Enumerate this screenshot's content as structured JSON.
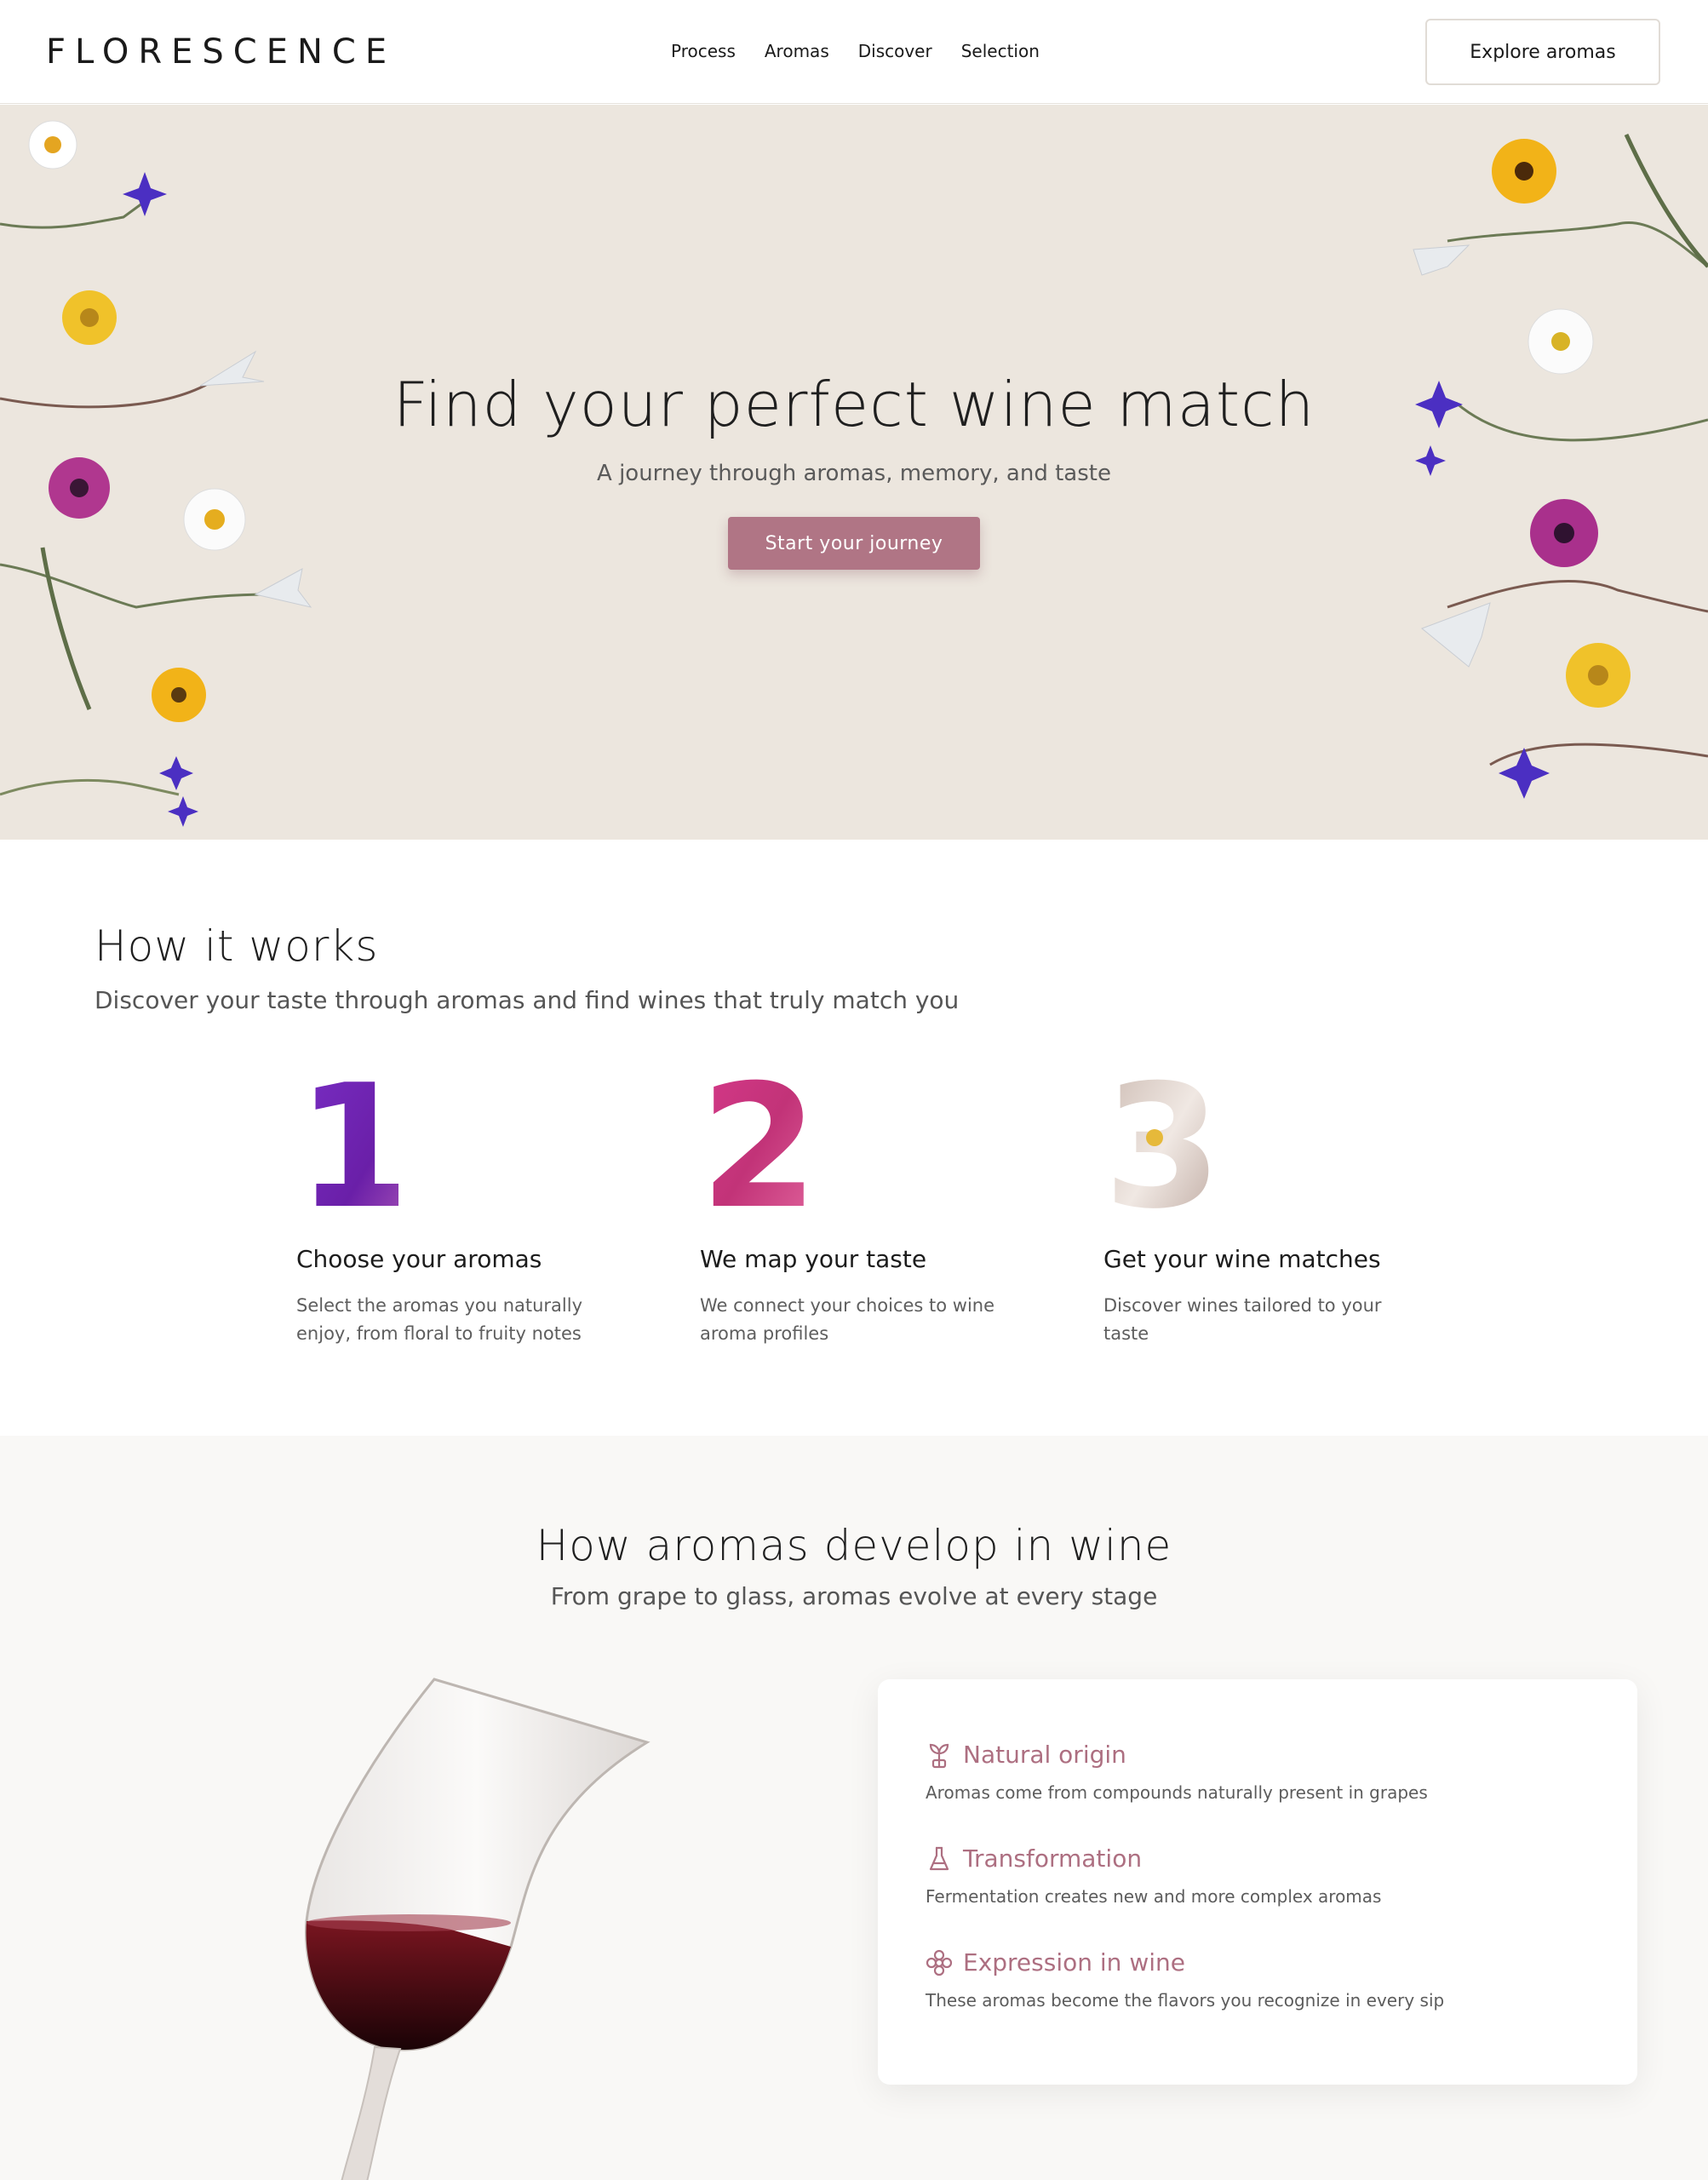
{
  "brand": "FLORESCENCE",
  "nav": {
    "links": [
      "Process",
      "Aromas",
      "Discover",
      "Selection"
    ],
    "cta": "Explore aromas"
  },
  "hero": {
    "title": "Find your perfect wine match",
    "subtitle": "A journey through aromas, memory, and taste",
    "button": "Start your journey"
  },
  "how": {
    "title": "How it works",
    "subtitle": "Discover your taste through aromas and find wines that truly match you",
    "steps": [
      {
        "number": "1",
        "title": "Choose your aromas",
        "text": "Select the aromas you naturally enjoy, from floral to fruity notes"
      },
      {
        "number": "2",
        "title": "We map your taste",
        "text": "We connect your choices to wine aroma profiles"
      },
      {
        "number": "3",
        "title": "Get your wine matches",
        "text": "Discover wines tailored to your taste"
      }
    ]
  },
  "aromas": {
    "title": "How aromas develop in wine",
    "subtitle": "From grape to glass, aromas evolve at every stage",
    "features": [
      {
        "icon": "sprout-icon",
        "title": "Natural origin",
        "text": "Aromas come from compounds naturally present in grapes"
      },
      {
        "icon": "flask-icon",
        "title": "Transformation",
        "text": "Fermentation creates new and more complex aromas"
      },
      {
        "icon": "flower-icon",
        "title": "Expression in wine",
        "text": "These aromas become the flavors you recognize in every sip"
      }
    ]
  },
  "colors": {
    "accent": "#b07585",
    "hero_bg": "#ece6de",
    "section_bg": "#f9f8f6"
  }
}
